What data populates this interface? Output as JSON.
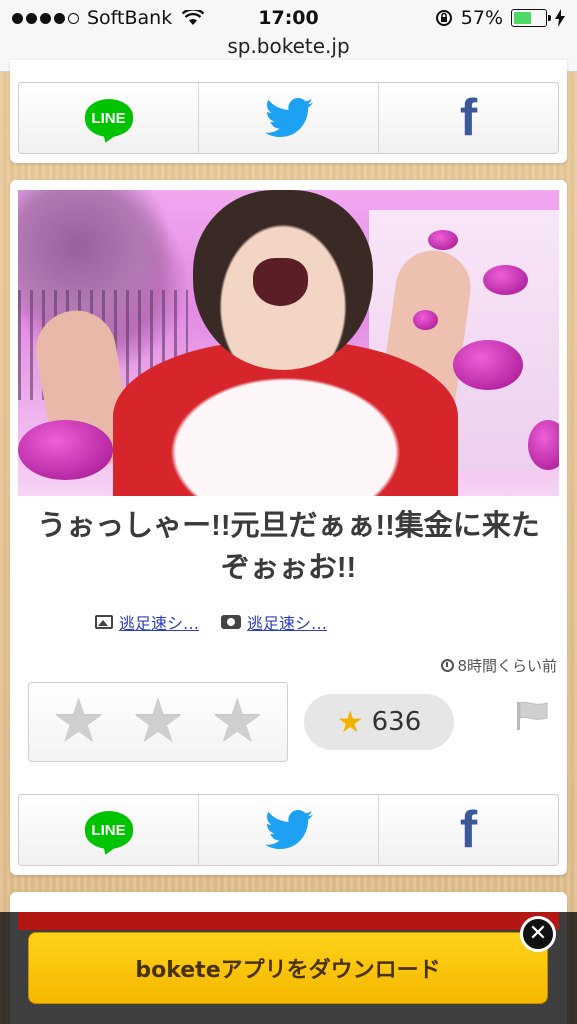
{
  "status_bar": {
    "carrier": "SoftBank",
    "time": "17:00",
    "battery_percent": "57%",
    "battery_level": 0.57,
    "url": "sp.bokete.jp"
  },
  "share": {
    "line_label": "LINE",
    "twitter_icon": "twitter-bird-icon",
    "facebook_label": "f"
  },
  "post": {
    "caption": "うぉっしゃー!!元旦だぁぁ!!集金に来たぞぉぉお!!",
    "image_credit": "逃足速シ…",
    "photo_credit": "逃足速シ…",
    "timestamp": "8時間くらい前",
    "rating_stars": [
      "★",
      "★",
      "★"
    ],
    "score": "636"
  },
  "banner": {
    "download_label": "boketeアプリをダウンロード",
    "close_label": "⊗"
  },
  "colors": {
    "line_green": "#00c300",
    "twitter_blue": "#1da1f2",
    "facebook_blue": "#3b5998",
    "banner_yellow": "#ffd21a",
    "link_blue": "#2a3ec4"
  }
}
